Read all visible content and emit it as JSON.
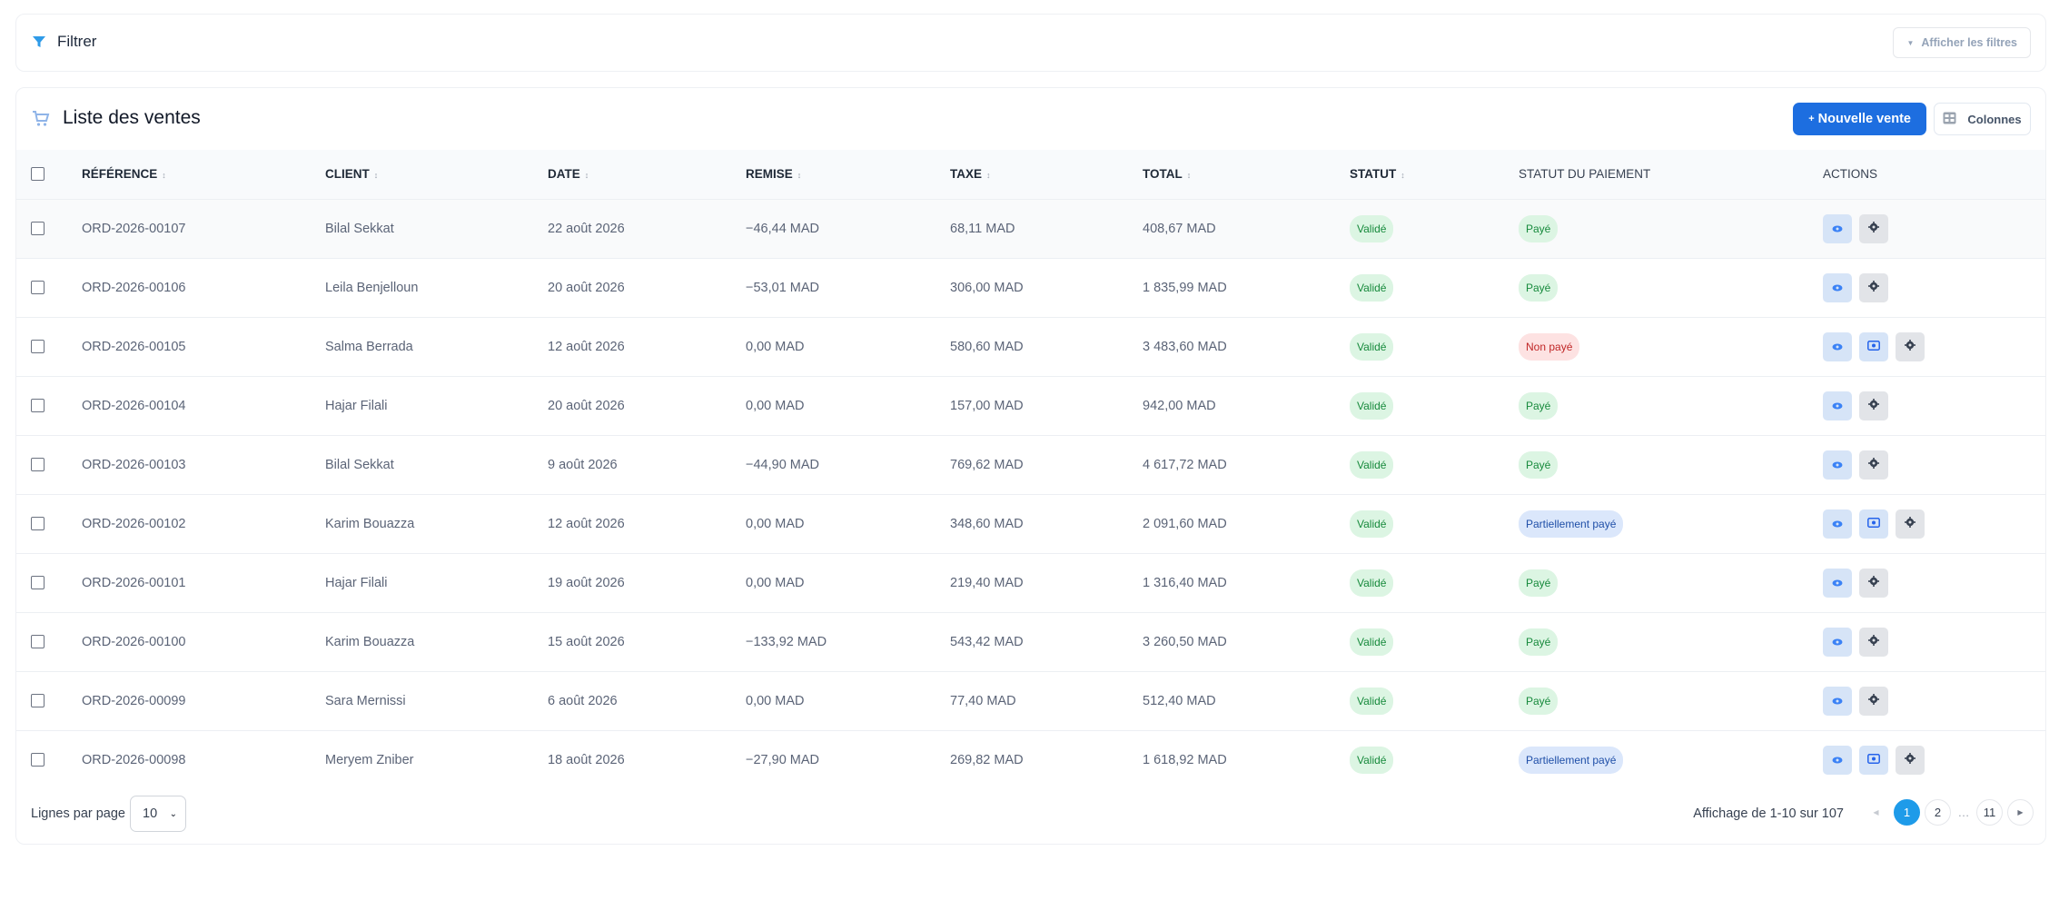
{
  "filter": {
    "title": "Filtrer",
    "show_filters_label": "Afficher les filtres"
  },
  "sales": {
    "title": "Liste des ventes",
    "new_sale_label": "Nouvelle vente",
    "new_sale_prefix": "+",
    "columns_label": "Colonnes",
    "headers": {
      "reference": "RÉFÉRENCE",
      "client": "CLIENT",
      "date": "DATE",
      "discount": "REMISE",
      "tax": "TAXE",
      "total": "TOTAL",
      "status": "STATUT",
      "payment_status": "STATUT DU PAIEMENT",
      "actions": "ACTIONS"
    },
    "rows": [
      {
        "reference": "ORD-2026-00107",
        "client": "Bilal Sekkat",
        "date": "22 août 2026",
        "discount": "−46,44 MAD",
        "tax": "68,11 MAD",
        "total": "408,67 MAD",
        "status": "Validé",
        "payment_status": "Payé",
        "payment_kind": "ok",
        "has_pay_action": false
      },
      {
        "reference": "ORD-2026-00106",
        "client": "Leila Benjelloun",
        "date": "20 août 2026",
        "discount": "−53,01 MAD",
        "tax": "306,00 MAD",
        "total": "1 835,99 MAD",
        "status": "Validé",
        "payment_status": "Payé",
        "payment_kind": "ok",
        "has_pay_action": false
      },
      {
        "reference": "ORD-2026-00105",
        "client": "Salma Berrada",
        "date": "12 août 2026",
        "discount": "0,00 MAD",
        "tax": "580,60 MAD",
        "total": "3 483,60 MAD",
        "status": "Validé",
        "payment_status": "Non payé",
        "payment_kind": "unpaid",
        "has_pay_action": true
      },
      {
        "reference": "ORD-2026-00104",
        "client": "Hajar Filali",
        "date": "20 août 2026",
        "discount": "0,00 MAD",
        "tax": "157,00 MAD",
        "total": "942,00 MAD",
        "status": "Validé",
        "payment_status": "Payé",
        "payment_kind": "ok",
        "has_pay_action": false
      },
      {
        "reference": "ORD-2026-00103",
        "client": "Bilal Sekkat",
        "date": "9 août 2026",
        "discount": "−44,90 MAD",
        "tax": "769,62 MAD",
        "total": "4 617,72 MAD",
        "status": "Validé",
        "payment_status": "Payé",
        "payment_kind": "ok",
        "has_pay_action": false
      },
      {
        "reference": "ORD-2026-00102",
        "client": "Karim Bouazza",
        "date": "12 août 2026",
        "discount": "0,00 MAD",
        "tax": "348,60 MAD",
        "total": "2 091,60 MAD",
        "status": "Validé",
        "payment_status": "Partiellement payé",
        "payment_kind": "partial",
        "has_pay_action": true
      },
      {
        "reference": "ORD-2026-00101",
        "client": "Hajar Filali",
        "date": "19 août 2026",
        "discount": "0,00 MAD",
        "tax": "219,40 MAD",
        "total": "1 316,40 MAD",
        "status": "Validé",
        "payment_status": "Payé",
        "payment_kind": "ok",
        "has_pay_action": false
      },
      {
        "reference": "ORD-2026-00100",
        "client": "Karim Bouazza",
        "date": "15 août 2026",
        "discount": "−133,92 MAD",
        "tax": "543,42 MAD",
        "total": "3 260,50 MAD",
        "status": "Validé",
        "payment_status": "Payé",
        "payment_kind": "ok",
        "has_pay_action": false
      },
      {
        "reference": "ORD-2026-00099",
        "client": "Sara Mernissi",
        "date": "6 août 2026",
        "discount": "0,00 MAD",
        "tax": "77,40 MAD",
        "total": "512,40 MAD",
        "status": "Validé",
        "payment_status": "Payé",
        "payment_kind": "ok",
        "has_pay_action": false
      },
      {
        "reference": "ORD-2026-00098",
        "client": "Meryem Zniber",
        "date": "18 août 2026",
        "discount": "−27,90 MAD",
        "tax": "269,82 MAD",
        "total": "1 618,92 MAD",
        "status": "Validé",
        "payment_status": "Partiellement payé",
        "payment_kind": "partial",
        "has_pay_action": true
      }
    ]
  },
  "footer": {
    "rows_per_page_label": "Lignes par page",
    "rows_per_page_value": "10",
    "showing_text": "Affichage de 1-10 sur 107",
    "pages": [
      "1",
      "2",
      "…",
      "11"
    ],
    "current_page": "1"
  },
  "colors": {
    "primary": "#1d6ee0",
    "active_page": "#1e9be9",
    "success_bg": "#dcf5e3",
    "success_fg": "#178a3c",
    "danger_bg": "#fde2e2",
    "danger_fg": "#c02626",
    "info_bg": "#dbe7fb",
    "info_fg": "#1f4fa8"
  },
  "icons": {
    "filter": "filter-icon",
    "cart": "cart-icon",
    "columns": "columns-icon",
    "view": "eye-icon",
    "pay": "money-icon",
    "more": "gear-icon"
  }
}
